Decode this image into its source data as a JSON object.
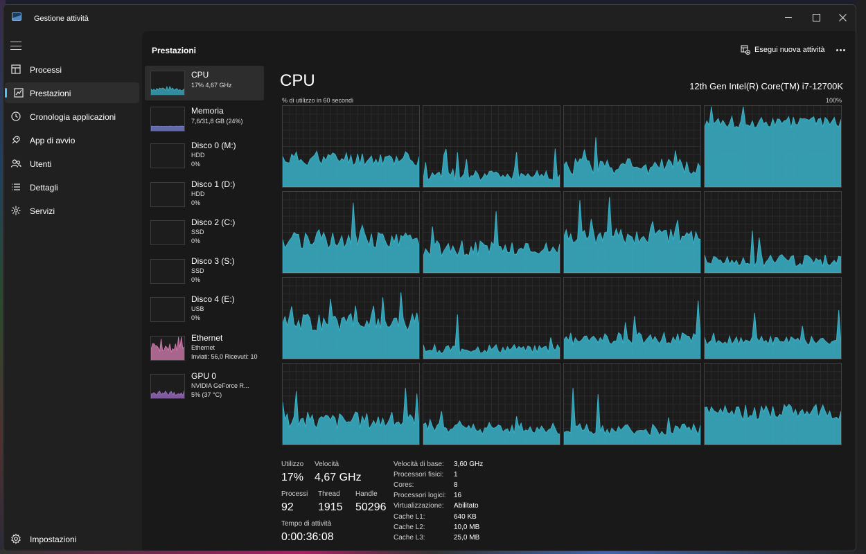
{
  "window": {
    "title": "Gestione attività"
  },
  "nav": {
    "items": [
      {
        "label": "Processi",
        "icon": "processes-icon"
      },
      {
        "label": "Prestazioni",
        "icon": "performance-icon",
        "active": true
      },
      {
        "label": "Cronologia applicazioni",
        "icon": "app-history-icon"
      },
      {
        "label": "App di avvio",
        "icon": "startup-apps-icon"
      },
      {
        "label": "Utenti",
        "icon": "users-icon"
      },
      {
        "label": "Dettagli",
        "icon": "details-icon"
      },
      {
        "label": "Servizi",
        "icon": "services-icon"
      }
    ],
    "settings_label": "Impostazioni"
  },
  "header": {
    "title": "Prestazioni",
    "run_task_label": "Esegui nuova attività"
  },
  "devices": [
    {
      "name": "CPU",
      "line1": "17% 4,67 GHz",
      "line2": "",
      "color": "#39b2c8",
      "active": true
    },
    {
      "name": "Memoria",
      "line1": "7,6/31,8 GB (24%)",
      "line2": "",
      "color": "#7b83d6"
    },
    {
      "name": "Disco 0 (M:)",
      "line1": "HDD",
      "line2": "0%",
      "color": "#5aa05a"
    },
    {
      "name": "Disco 1 (D:)",
      "line1": "HDD",
      "line2": "0%",
      "color": "#5aa05a"
    },
    {
      "name": "Disco 2 (C:)",
      "line1": "SSD",
      "line2": "0%",
      "color": "#5aa05a"
    },
    {
      "name": "Disco 3 (S:)",
      "line1": "SSD",
      "line2": "0%",
      "color": "#5aa05a"
    },
    {
      "name": "Disco 4 (E:)",
      "line1": "USB",
      "line2": "0%",
      "color": "#5aa05a"
    },
    {
      "name": "Ethernet",
      "line1": "Ethernet",
      "line2": "Inviati: 56,0 Ricevuti: 10",
      "color": "#d77fb3"
    },
    {
      "name": "GPU 0",
      "line1": "NVIDIA GeForce R...",
      "line2": "5% (37 °C)",
      "color": "#a070c8"
    }
  ],
  "cpu": {
    "title": "CPU",
    "model": "12th Gen Intel(R) Core(TM) i7-12700K",
    "axis_left": "% di utilizzo in 60 secondi",
    "axis_right": "100%",
    "graph_color": "#39b2c8",
    "graph_count": 16
  },
  "stats": {
    "utilization_label": "Utilizzo",
    "utilization_value": "17%",
    "speed_label": "Velocità",
    "speed_value": "4,67 GHz",
    "processes_label": "Processi",
    "processes_value": "92",
    "threads_label": "Thread",
    "threads_value": "1915",
    "handles_label": "Handle",
    "handles_value": "50296",
    "uptime_label": "Tempo di attività",
    "uptime_value": "0:00:36:08"
  },
  "specs": [
    {
      "key": "Velocità di base:",
      "value": "3,60 GHz"
    },
    {
      "key": "Processori fisici:",
      "value": "1"
    },
    {
      "key": "Cores:",
      "value": "8"
    },
    {
      "key": "Processori logici:",
      "value": "16"
    },
    {
      "key": "Virtualizzazione:",
      "value": "Abilitato"
    },
    {
      "key": "Cache L1:",
      "value": "640 KB"
    },
    {
      "key": "Cache L2:",
      "value": "10,0 MB"
    },
    {
      "key": "Cache L3:",
      "value": "25,0 MB"
    }
  ]
}
